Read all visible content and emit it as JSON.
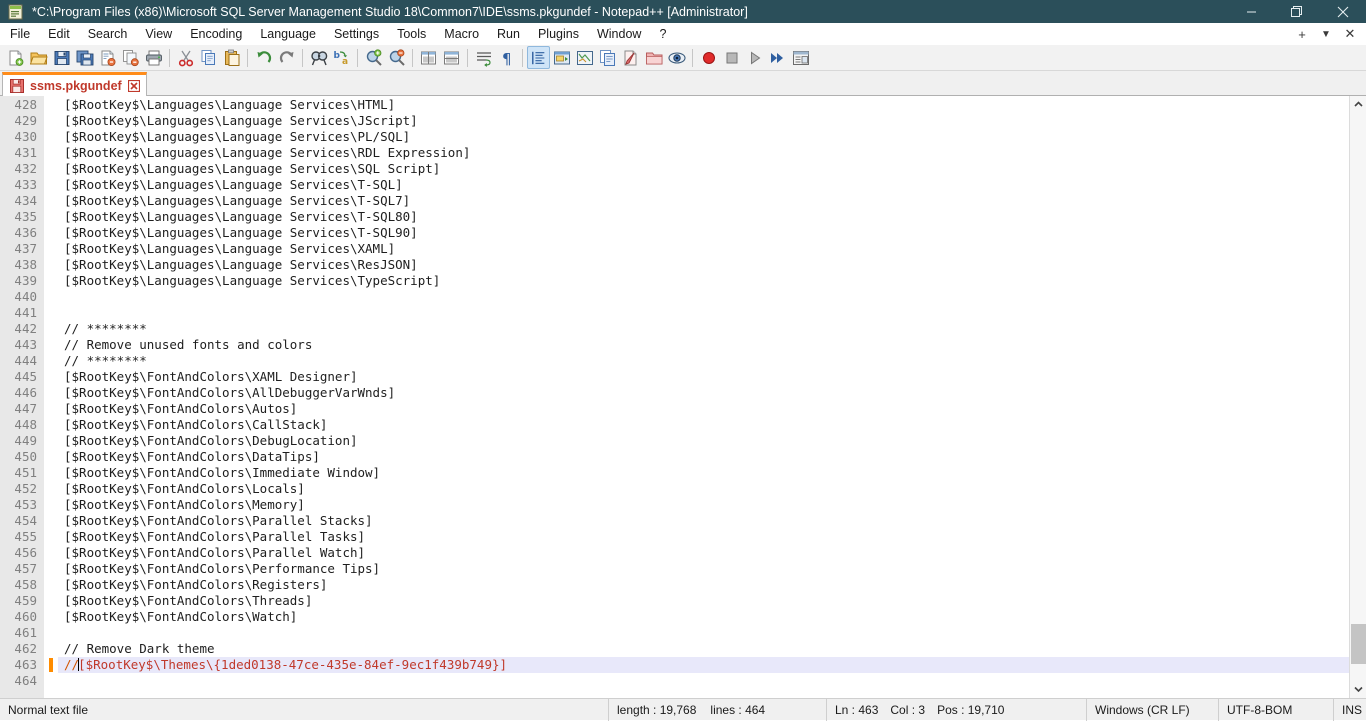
{
  "window": {
    "title": "*C:\\Program Files (x86)\\Microsoft SQL Server Management Studio 18\\Common7\\IDE\\ssms.pkgundef - Notepad++ [Administrator]",
    "app_icon": "notepad-plus-plus-icon",
    "minimize_label": "–",
    "maximize_label": "❐",
    "close_label": "✕",
    "titlebar_color": "#2b4f5a"
  },
  "menubar": {
    "items": [
      {
        "label": "File"
      },
      {
        "label": "Edit"
      },
      {
        "label": "Search"
      },
      {
        "label": "View"
      },
      {
        "label": "Encoding"
      },
      {
        "label": "Language"
      },
      {
        "label": "Settings"
      },
      {
        "label": "Tools"
      },
      {
        "label": "Macro"
      },
      {
        "label": "Run"
      },
      {
        "label": "Plugins"
      },
      {
        "label": "Window"
      },
      {
        "label": "?"
      }
    ],
    "right_buttons": [
      {
        "name": "new-tab-plus-button",
        "label": "+"
      },
      {
        "name": "tab-list-dropdown-button",
        "label": "▼"
      },
      {
        "name": "close-tab-button",
        "label": "✕"
      }
    ]
  },
  "toolbar": {
    "groups": [
      [
        "new-file-icon",
        "open-file-icon",
        "save-icon",
        "save-all-icon",
        "close-file-icon",
        "close-all-files-icon",
        "print-icon"
      ],
      [
        "cut-icon",
        "copy-icon",
        "paste-icon"
      ],
      [
        "undo-icon",
        "redo-icon"
      ],
      [
        "find-icon",
        "replace-icon"
      ],
      [
        "zoom-in-icon",
        "zoom-out-icon"
      ],
      [
        "sync-vertical-scroll-icon",
        "sync-horizontal-scroll-icon"
      ],
      [
        "word-wrap-icon",
        "show-all-characters-icon"
      ],
      [
        "show-indent-guide-icon",
        "user-defined-dialog-icon",
        "show-document-map-icon",
        "function-list-icon",
        "document-switcher-icon",
        "folder-as-workspace-icon",
        "monitoring-icon"
      ],
      [
        "start-record-macro-icon",
        "stop-record-macro-icon",
        "playback-macro-icon",
        "run-macro-multiple-icon",
        "save-current-macro-icon"
      ]
    ],
    "active_button": "show-indent-guide-icon"
  },
  "tabs": [
    {
      "label": "ssms.pkgundef",
      "icon": "save-floppy-icon",
      "close_label": "✕",
      "modified": true,
      "active": true
    }
  ],
  "editor": {
    "first_line": 428,
    "current_line": 463,
    "lines": [
      {
        "n": 428,
        "text": "[$RootKey$\\Languages\\Language Services\\HTML]"
      },
      {
        "n": 429,
        "text": "[$RootKey$\\Languages\\Language Services\\JScript]"
      },
      {
        "n": 430,
        "text": "[$RootKey$\\Languages\\Language Services\\PL/SQL]"
      },
      {
        "n": 431,
        "text": "[$RootKey$\\Languages\\Language Services\\RDL Expression]"
      },
      {
        "n": 432,
        "text": "[$RootKey$\\Languages\\Language Services\\SQL Script]"
      },
      {
        "n": 433,
        "text": "[$RootKey$\\Languages\\Language Services\\T-SQL]"
      },
      {
        "n": 434,
        "text": "[$RootKey$\\Languages\\Language Services\\T-SQL7]"
      },
      {
        "n": 435,
        "text": "[$RootKey$\\Languages\\Language Services\\T-SQL80]"
      },
      {
        "n": 436,
        "text": "[$RootKey$\\Languages\\Language Services\\T-SQL90]"
      },
      {
        "n": 437,
        "text": "[$RootKey$\\Languages\\Language Services\\XAML]"
      },
      {
        "n": 438,
        "text": "[$RootKey$\\Languages\\Language Services\\ResJSON]"
      },
      {
        "n": 439,
        "text": "[$RootKey$\\Languages\\Language Services\\TypeScript]"
      },
      {
        "n": 440,
        "text": ""
      },
      {
        "n": 441,
        "text": ""
      },
      {
        "n": 442,
        "text": "// ********"
      },
      {
        "n": 443,
        "text": "// Remove unused fonts and colors"
      },
      {
        "n": 444,
        "text": "// ********"
      },
      {
        "n": 445,
        "text": "[$RootKey$\\FontAndColors\\XAML Designer]"
      },
      {
        "n": 446,
        "text": "[$RootKey$\\FontAndColors\\AllDebuggerVarWnds]"
      },
      {
        "n": 447,
        "text": "[$RootKey$\\FontAndColors\\Autos]"
      },
      {
        "n": 448,
        "text": "[$RootKey$\\FontAndColors\\CallStack]"
      },
      {
        "n": 449,
        "text": "[$RootKey$\\FontAndColors\\DebugLocation]"
      },
      {
        "n": 450,
        "text": "[$RootKey$\\FontAndColors\\DataTips]"
      },
      {
        "n": 451,
        "text": "[$RootKey$\\FontAndColors\\Immediate Window]"
      },
      {
        "n": 452,
        "text": "[$RootKey$\\FontAndColors\\Locals]"
      },
      {
        "n": 453,
        "text": "[$RootKey$\\FontAndColors\\Memory]"
      },
      {
        "n": 454,
        "text": "[$RootKey$\\FontAndColors\\Parallel Stacks]"
      },
      {
        "n": 455,
        "text": "[$RootKey$\\FontAndColors\\Parallel Tasks]"
      },
      {
        "n": 456,
        "text": "[$RootKey$\\FontAndColors\\Parallel Watch]"
      },
      {
        "n": 457,
        "text": "[$RootKey$\\FontAndColors\\Performance Tips]"
      },
      {
        "n": 458,
        "text": "[$RootKey$\\FontAndColors\\Registers]"
      },
      {
        "n": 459,
        "text": "[$RootKey$\\FontAndColors\\Threads]"
      },
      {
        "n": 460,
        "text": "[$RootKey$\\FontAndColors\\Watch]"
      },
      {
        "n": 461,
        "text": ""
      },
      {
        "n": 462,
        "text": "// Remove Dark theme"
      },
      {
        "n": 463,
        "text": "//[$RootKey$\\Themes\\{1ded0138-47ce-435e-84ef-9ec1f439b749}]"
      },
      {
        "n": 464,
        "text": ""
      }
    ],
    "highlighted_line_parts": {
      "comment_prefix": "//",
      "body": "[$RootKey$\\Themes\\{1ded0138-47ce-435e-84ef-9ec1f439b749}]"
    },
    "colors": {
      "text": "#1e1e1e",
      "gutter_bg": "#e8e8e8",
      "gutter_text": "#808080",
      "current_line_bg": "#e8e8fa",
      "change_marker": "#ff8c00",
      "accent_red": "#c0392b"
    }
  },
  "scrollbar": {
    "up_arrow": "chevron-up-icon",
    "down_arrow": "chevron-down-icon"
  },
  "statusbar": {
    "doc_type": "Normal text file",
    "length_label": "length : 19,768",
    "lines_label": "lines : 464",
    "ln_label": "Ln : 463",
    "col_label": "Col : 3",
    "pos_label": "Pos : 19,710",
    "eol": "Windows (CR LF)",
    "encoding": "UTF-8-BOM",
    "insert_mode": "INS"
  }
}
